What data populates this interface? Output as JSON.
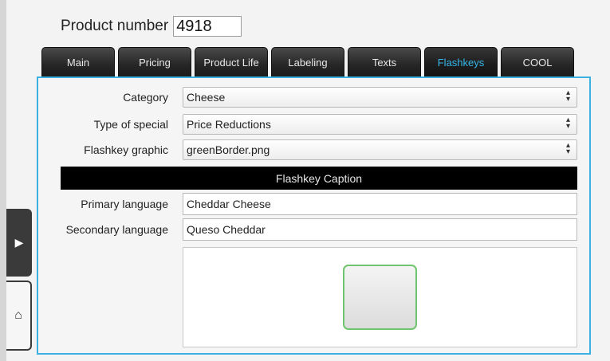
{
  "product": {
    "label": "Product number",
    "value": "4918"
  },
  "tabs": [
    {
      "label": "Main",
      "active": false
    },
    {
      "label": "Pricing",
      "active": false
    },
    {
      "label": "Product Life",
      "active": false
    },
    {
      "label": "Labeling",
      "active": false
    },
    {
      "label": "Texts",
      "active": false
    },
    {
      "label": "Flashkeys",
      "active": true
    },
    {
      "label": "COOL",
      "active": false
    }
  ],
  "fields": {
    "category": {
      "label": "Category",
      "value": "Cheese"
    },
    "special": {
      "label": "Type of special",
      "value": "Price Reductions"
    },
    "graphic": {
      "label": "Flashkey graphic",
      "value": "greenBorder.png"
    }
  },
  "caption": {
    "header": "Flashkey Caption",
    "primary": {
      "label": "Primary language",
      "value": "Cheddar Cheese"
    },
    "secondary": {
      "label": "Secondary language",
      "value": "Queso Cheddar"
    }
  },
  "side": {
    "expand_icon": "chevron-right-icon",
    "home_icon": "home-icon"
  },
  "colors": {
    "accent": "#3ab1e0",
    "active_tab_text": "#35b6e8",
    "flashkey_border": "#6fc46e"
  }
}
